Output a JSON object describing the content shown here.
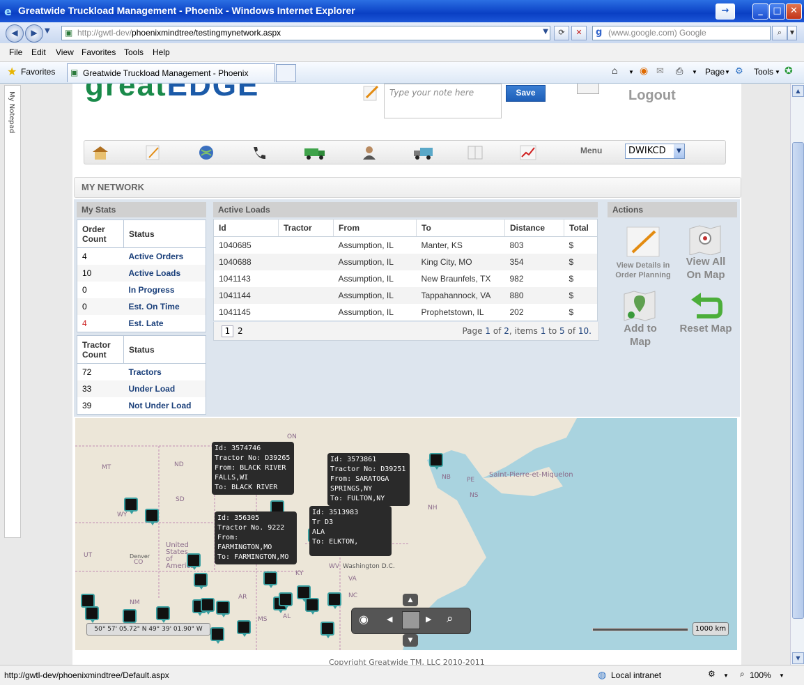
{
  "window": {
    "title": "Greatwide Truckload Management - Phoenix - Windows Internet Explorer"
  },
  "address": {
    "url_prefix": "http://gwtl-dev/",
    "url_path": "phoenixmindtree/testingmynetwork.aspx",
    "search_placeholder": "(www.google.com) Google"
  },
  "menubar": [
    "File",
    "Edit",
    "View",
    "Favorites",
    "Tools",
    "Help"
  ],
  "favbar": {
    "favorites_label": "Favorites",
    "tab_title": "Greatwide Truckload Management - Phoenix",
    "page_label": "Page",
    "tools_label": "Tools"
  },
  "notepad": {
    "label": "My Notepad"
  },
  "header": {
    "logo_part1": "great",
    "logo_part2": "EDGE",
    "note_placeholder": "Type your note here",
    "save_label": "Save",
    "logout_label": "Logout",
    "menu_label": "Menu",
    "menu_selected": "DWIKCD"
  },
  "section_title": "MY NETWORK",
  "stats": {
    "header": "My Stats",
    "orders_columns": [
      "Order Count",
      "Status"
    ],
    "orders": [
      {
        "count": "4",
        "status": "Active Orders"
      },
      {
        "count": "10",
        "status": "Active Loads"
      },
      {
        "count": "0",
        "status": "In Progress"
      },
      {
        "count": "0",
        "status": "Est. On Time"
      },
      {
        "count": "4",
        "status": "Est. Late"
      }
    ],
    "tractors_columns": [
      "Tractor Count",
      "Status"
    ],
    "tractors": [
      {
        "count": "72",
        "status": "Tractors"
      },
      {
        "count": "33",
        "status": "Under Load"
      },
      {
        "count": "39",
        "status": "Not Under Load"
      }
    ],
    "late_color": "#cc2020"
  },
  "loads": {
    "header": "Active Loads",
    "columns": [
      "Id",
      "Tractor",
      "From",
      "To",
      "Distance",
      "Total"
    ],
    "rows": [
      {
        "id": "1040685",
        "tractor": "",
        "from": "Assumption, IL",
        "to": "Manter, KS",
        "distance": "803",
        "total": "$"
      },
      {
        "id": "1040688",
        "tractor": "",
        "from": "Assumption, IL",
        "to": "King City, MO",
        "distance": "354",
        "total": "$"
      },
      {
        "id": "1041143",
        "tractor": "",
        "from": "Assumption, IL",
        "to": "New Braunfels, TX",
        "distance": "982",
        "total": "$"
      },
      {
        "id": "1041144",
        "tractor": "",
        "from": "Assumption, IL",
        "to": "Tappahannock, VA",
        "distance": "880",
        "total": "$"
      },
      {
        "id": "1041145",
        "tractor": "",
        "from": "Assumption, IL",
        "to": "Prophetstown, IL",
        "distance": "202",
        "total": "$"
      }
    ],
    "pager": {
      "pages": [
        "1",
        "2"
      ],
      "info_page": "Page",
      "current": "1",
      "of": "of",
      "total_pages": "2",
      "items": ", items",
      "first": "1",
      "to": "to",
      "last": "5",
      "of2": "of",
      "total_items": "10."
    }
  },
  "actions": {
    "header": "Actions",
    "view_details": "View Details in Order Planning",
    "view_all": "View All On Map",
    "add_to_map": "Add to Map",
    "reset_map": "Reset Map"
  },
  "map": {
    "tooltips": [
      {
        "lines": [
          "Id: 3574746",
          "Tractor No: D39265",
          "From: BLACK RIVER",
          "FALLS,WI",
          "To: BLACK RIVER"
        ]
      },
      {
        "lines": [
          "Id: 3573861",
          "Tractor No: D39251",
          "From: SARATOGA",
          "SPRINGS,NY",
          "To: FULTON,NY"
        ]
      },
      {
        "lines": [
          "Id: 356305",
          "Tractor No. 9222",
          "From:",
          "FARMINGTON,MO",
          "To: FARMINGTON,MO"
        ]
      },
      {
        "lines": [
          "Id: 3513983",
          "Tr       D3",
          "     ALA",
          "To: ELKTON,"
        ]
      }
    ],
    "labels": {
      "on": "ON",
      "mt": "MT",
      "nd": "ND",
      "sd": "SD",
      "wy": "WY",
      "ut": "UT",
      "co": "CO",
      "nm": "NM",
      "nb": "NB",
      "pe": "PE",
      "ns": "NS",
      "nh": "NH",
      "saint_pierre": "Saint-Pierre-et-Miquelon",
      "us": "United States of America",
      "denver": "Denver",
      "ky": "KY",
      "ar": "AR",
      "nc": "NC",
      "ms": "MS",
      "al": "AL",
      "ga": "GA",
      "va": "VA",
      "wv": "WV",
      "washington": "Washington D.C."
    },
    "coordinates": "50° 57' 05.72\" N 49° 39' 01.90\" W",
    "scale": "1000 km"
  },
  "copyright": "Copyright Greatwide TM, LLC 2010-2011",
  "status": {
    "url": "http://gwtl-dev/phoenixmindtree/Default.aspx",
    "zone": "Local intranet",
    "zoom": "100%"
  }
}
